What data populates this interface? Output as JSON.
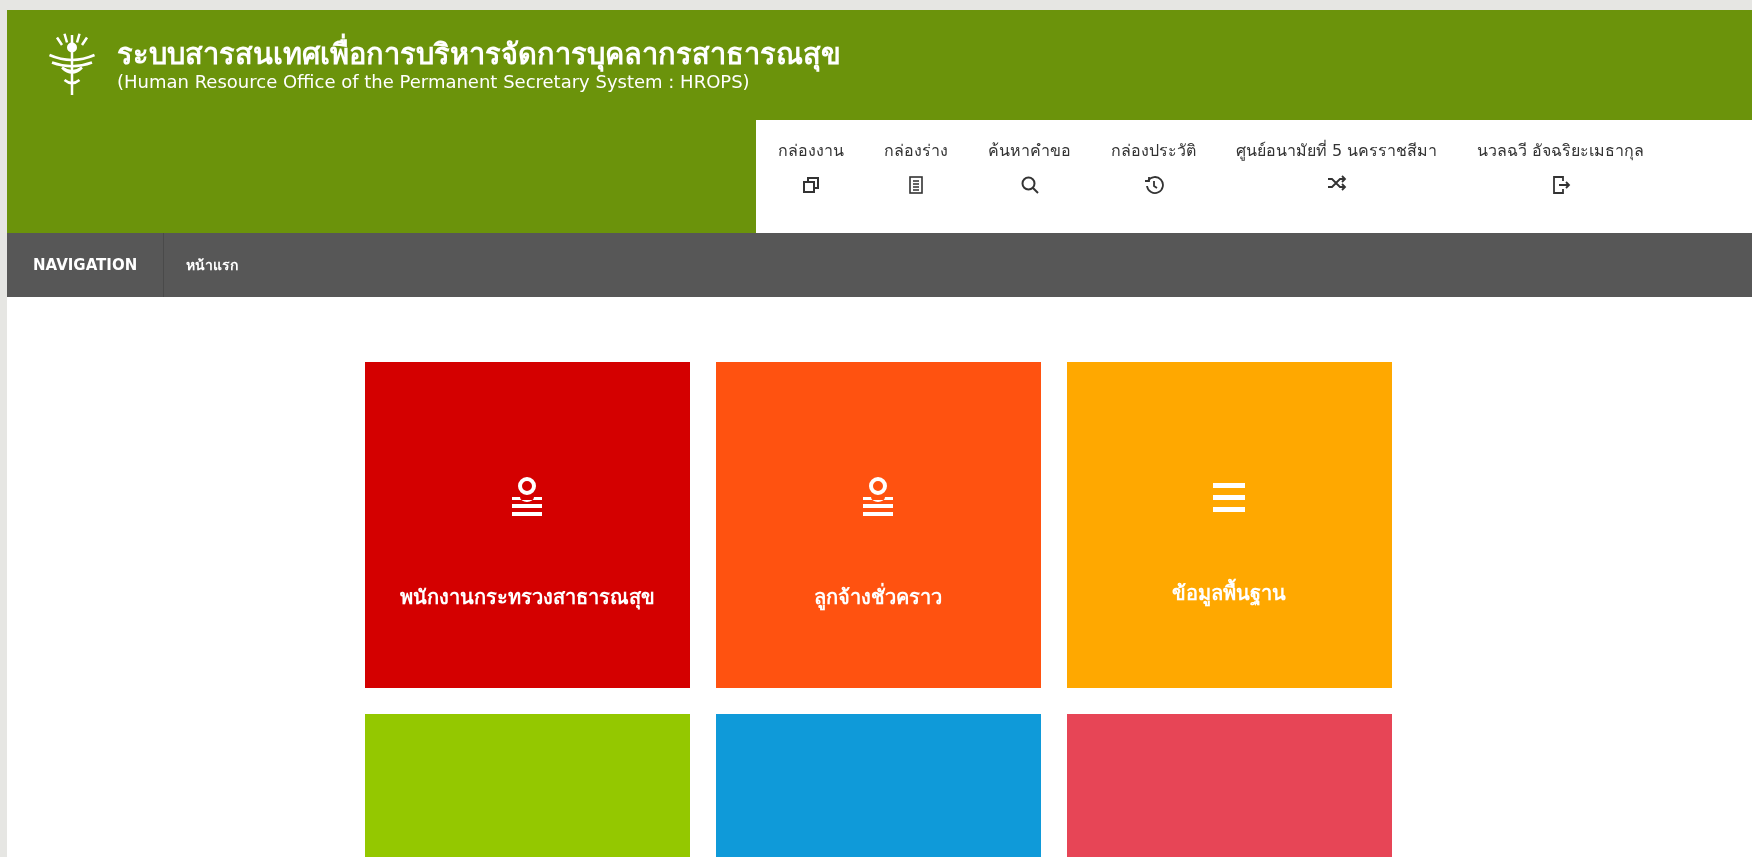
{
  "header": {
    "title": "ระบบสารสนเทศเพื่อการบริหารจัดการบุคลากรสาธารณสุข",
    "subtitle": "(Human Resource Office of the Permanent Secretary System : HROPS)"
  },
  "toolbar": [
    {
      "label": "กล่องงาน"
    },
    {
      "label": "กล่องร่าง"
    },
    {
      "label": "ค้นหาคำขอ"
    },
    {
      "label": "กล่องประวัติ"
    },
    {
      "label": "ศูนย์อนามัยที่ 5 นครราชสีมา"
    },
    {
      "label": "นวลฉวี อัจฉริยะเมธากุล"
    }
  ],
  "nav": {
    "label": "NAVIGATION",
    "links": [
      "หน้าแรก"
    ]
  },
  "tiles": [
    {
      "label": "พนักงานกระทรวงสาธารณสุข",
      "color": "#d40000"
    },
    {
      "label": "ลูกจ้างชั่วคราว",
      "color": "#ff5210"
    },
    {
      "label": "ข้อมูลพื้นฐาน",
      "color": "#ffa800"
    },
    {
      "color": "#94c800"
    },
    {
      "color": "#0f9ad9"
    },
    {
      "color": "#e74556"
    }
  ]
}
